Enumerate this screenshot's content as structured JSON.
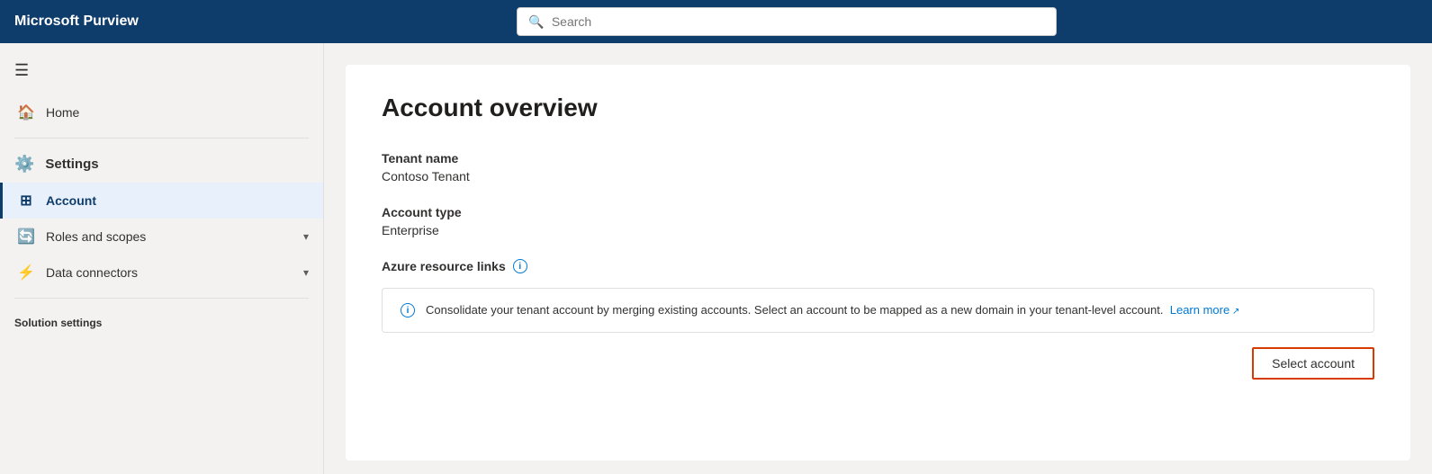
{
  "app": {
    "title": "Microsoft Purview"
  },
  "topnav": {
    "search_placeholder": "Search"
  },
  "sidebar": {
    "hamburger_label": "☰",
    "home_label": "Home",
    "settings_label": "Settings",
    "account_label": "Account",
    "roles_and_scopes_label": "Roles and scopes",
    "data_connectors_label": "Data connectors",
    "solution_settings_label": "Solution settings"
  },
  "main": {
    "page_title": "Account overview",
    "tenant_name_label": "Tenant name",
    "tenant_name_value": "Contoso Tenant",
    "account_type_label": "Account type",
    "account_type_value": "Enterprise",
    "azure_resource_links_label": "Azure resource links",
    "azure_info_text": "Consolidate your tenant account by merging existing accounts. Select an account to be mapped as a new domain in your tenant-level account.",
    "learn_more_label": "Learn more",
    "select_account_label": "Select account"
  }
}
